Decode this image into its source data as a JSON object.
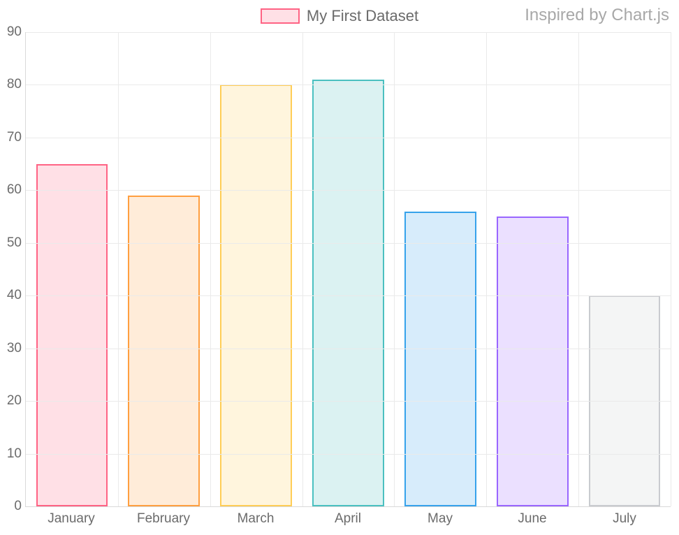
{
  "header": {
    "legend_label": "My First Dataset",
    "credit": "Inspired by Chart.js",
    "swatch_fill": "rgba(255,99,132,0.2)",
    "swatch_border": "rgb(255,99,132)"
  },
  "chart_data": {
    "type": "bar",
    "categories": [
      "January",
      "February",
      "March",
      "April",
      "May",
      "June",
      "July"
    ],
    "values": [
      65,
      59,
      80,
      81,
      56,
      55,
      40
    ],
    "bar_fills": [
      "rgba(255,99,132,0.2)",
      "rgba(255,159,64,0.2)",
      "rgba(255,205,86,0.2)",
      "rgba(75,192,192,0.2)",
      "rgba(54,162,235,0.2)",
      "rgba(153,102,255,0.2)",
      "rgba(201,203,207,0.2)"
    ],
    "bar_borders": [
      "rgb(255,99,132)",
      "rgb(255,159,64)",
      "rgb(255,205,86)",
      "rgb(75,192,192)",
      "rgb(54,162,235)",
      "rgb(153,102,255)",
      "rgb(201,203,207)"
    ],
    "title": "",
    "xlabel": "",
    "ylabel": "",
    "ylim": [
      0,
      90
    ],
    "y_ticks": [
      0,
      10,
      20,
      30,
      40,
      50,
      60,
      70,
      80,
      90
    ]
  }
}
